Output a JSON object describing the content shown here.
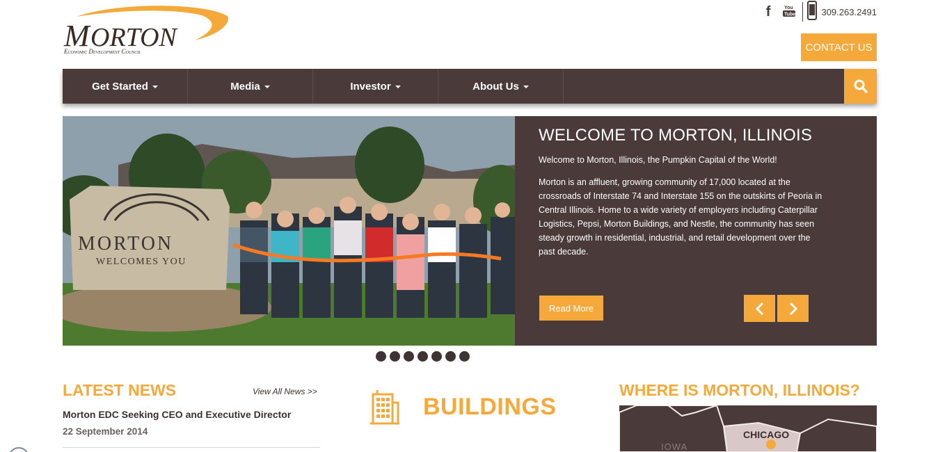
{
  "header": {
    "logo": {
      "name": "MORTON",
      "tagline": "Economic Development Council"
    },
    "social": {
      "facebook_icon": "facebook-icon",
      "youtube_icon": "youtube-icon",
      "phone_icon": "mobile-phone-icon"
    },
    "phone": "309.263.2491",
    "contact_label": "CONTACT US"
  },
  "nav": {
    "items": [
      {
        "label": "Get Started"
      },
      {
        "label": "Media"
      },
      {
        "label": "Investor"
      },
      {
        "label": "About Us"
      }
    ],
    "search_icon": "search-icon"
  },
  "slider": {
    "title": "WELCOME TO MORTON, ILLINOIS",
    "lead": "Welcome to Morton, Illinois, the Pumpkin Capital of the World!",
    "body": "Morton is an affluent, growing community of 17,000 located at the crossroads of Interstate 74 and Interstate 155 on the outskirts of Peoria in Central Illinois. Home to a wide variety of employers including Caterpillar Logistics, Pepsi, Morton Buildings, and Nestle, the community has seen steady growth in residential, industrial, and retail development over the past decade.",
    "read_more": "Read More",
    "sign_line1": "MORTON",
    "sign_line2": "WELCOMES YOU",
    "dot_count": 7
  },
  "news": {
    "title": "LATEST NEWS",
    "view_all": "View All News >>",
    "items": [
      {
        "headline": "Morton EDC Seeking CEO and Executive Director",
        "date": "22 September 2014"
      }
    ]
  },
  "buildings": {
    "title": "BUILDINGS",
    "icon": "building-icon"
  },
  "where": {
    "title": "WHERE IS MORTON, ILLINOIS?",
    "map_labels": {
      "chicago": "CHICAGO",
      "iowa": "IOWA"
    }
  },
  "colors": {
    "accent": "#f5a93a",
    "brown": "#4a3a3a"
  }
}
